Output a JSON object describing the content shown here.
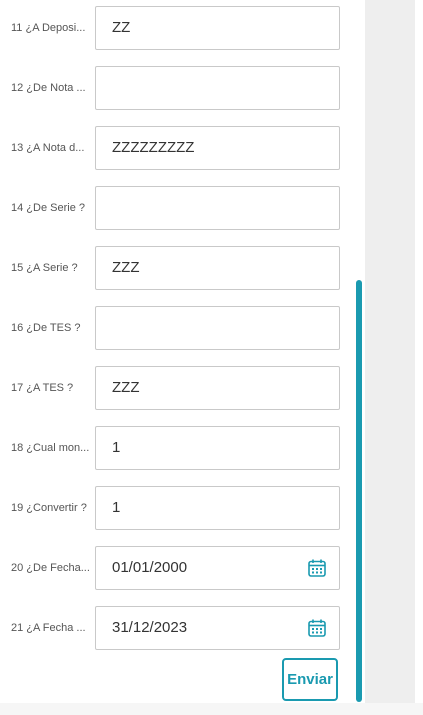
{
  "form": {
    "rows": [
      {
        "label": "11 ¿A Deposi...",
        "value": "ZZ"
      },
      {
        "label": "12 ¿De Nota ...",
        "value": ""
      },
      {
        "label": "13 ¿A Nota d...",
        "value": "ZZZZZZZZZ"
      },
      {
        "label": "14 ¿De Serie ?",
        "value": ""
      },
      {
        "label": "15 ¿A Serie ?",
        "value": "ZZZ"
      },
      {
        "label": "16 ¿De TES ?",
        "value": ""
      },
      {
        "label": "17 ¿A TES ?",
        "value": "ZZZ"
      },
      {
        "label": "18 ¿Cual mon...",
        "value": "1"
      },
      {
        "label": "19 ¿Convertir ?",
        "value": "1"
      },
      {
        "label": "20 ¿De Fecha...",
        "value": "01/01/2000",
        "icon": "calendar-icon"
      },
      {
        "label": "21 ¿A Fecha ...",
        "value": "31/12/2023",
        "icon": "calendar-icon"
      }
    ],
    "submit_label": "Enviar"
  },
  "colors": {
    "accent": "#1a9ab0",
    "field_border": "#c9c9c9",
    "label_text": "#555555",
    "panel": "#eeeeee"
  }
}
